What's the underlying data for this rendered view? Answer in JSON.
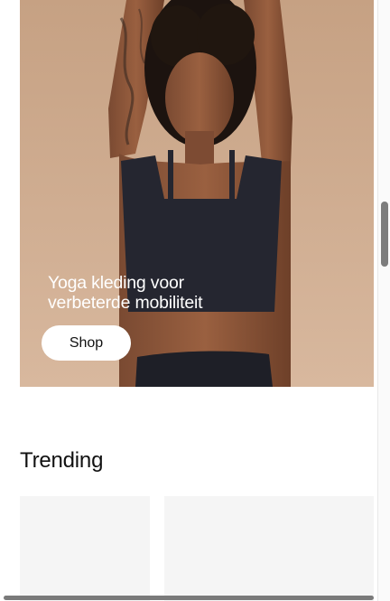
{
  "hero": {
    "headline_line1": "Yoga kleding voor",
    "headline_line2": "verbeterde mobiliteit",
    "shop_label": "Shop",
    "image_subject": "woman-in-black-sports-bra"
  },
  "trending": {
    "title": "Trending",
    "products": [
      {
        "placeholder": true
      },
      {
        "placeholder": true
      }
    ]
  },
  "colors": {
    "hero_background": "#d4b196",
    "card_background": "#f5f5f5",
    "text": "#111111",
    "button_background": "#ffffff"
  }
}
